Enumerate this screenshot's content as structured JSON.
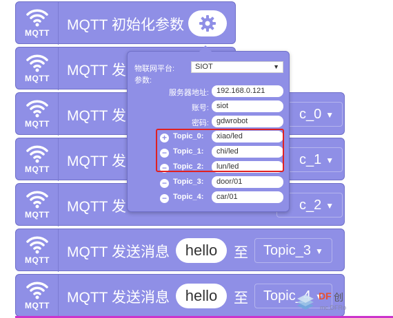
{
  "blocks": {
    "init": {
      "icon_label": "MQTT",
      "title": "MQTT 初始化参数",
      "gear_icon": "gear-icon"
    },
    "send_partial": [
      {
        "icon_label": "MQTT",
        "title": "MQTT 发",
        "topic": ""
      },
      {
        "icon_label": "MQTT",
        "title": "MQTT 发",
        "topic": "c_0"
      },
      {
        "icon_label": "MQTT",
        "title": "MQTT 发",
        "topic": "c_1"
      },
      {
        "icon_label": "MQTT",
        "title": "MQTT 发",
        "topic": "c_2"
      }
    ],
    "send_full": [
      {
        "icon_label": "MQTT",
        "title": "MQTT 发送消息",
        "message": "hello",
        "to": "至",
        "topic": "Topic_3"
      },
      {
        "icon_label": "MQTT",
        "title": "MQTT 发送消息",
        "message": "hello",
        "to": "至",
        "topic": "Topic_4"
      }
    ]
  },
  "panel": {
    "platform_label": "物联网平台:",
    "platform_value": "SIOT",
    "params_label": "参数:",
    "server_label": "服务器地址:",
    "server_value": "192.168.0.121",
    "account_label": "账号:",
    "account_value": "siot",
    "password_label": "密码:",
    "password_value": "gdwrobot",
    "topics": [
      {
        "label": "Topic_0:",
        "value": "xiao/led",
        "button": "+"
      },
      {
        "label": "Topic_1:",
        "value": "chi/led",
        "button": "−"
      },
      {
        "label": "Topic_2:",
        "value": "lun/led",
        "button": "−"
      },
      {
        "label": "Topic_3:",
        "value": "door/01",
        "button": "−"
      },
      {
        "label": "Topic_4:",
        "value": "car/01",
        "button": "−"
      }
    ]
  },
  "watermark": {
    "brand": "DF",
    "cn": "创",
    "url": "mc.DFRo"
  },
  "colors": {
    "block": "#8f8fe6",
    "highlight": "#e02020",
    "accent_bar": "#cc33cc"
  }
}
